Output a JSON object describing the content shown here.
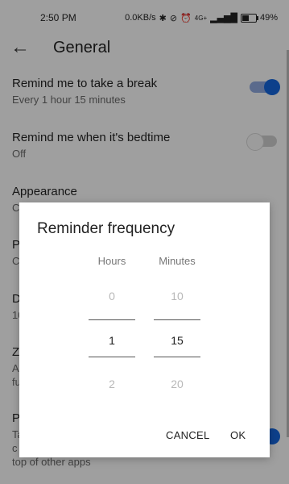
{
  "status_bar": {
    "time": "2:50 PM",
    "network_speed": "0.0KB/s",
    "battery_percent": "49%",
    "battery_level": 0.49,
    "signal_label": "4G+"
  },
  "app_bar": {
    "title": "General",
    "back_icon": "arrow-left-icon"
  },
  "settings": [
    {
      "title": "Remind me to take a break",
      "subtitle": "Every 1 hour 15 minutes",
      "toggle": true
    },
    {
      "title": "Remind me when it's bedtime",
      "subtitle": "Off",
      "toggle": false
    },
    {
      "title": "Appearance",
      "subtitle": "C"
    },
    {
      "title": "P",
      "subtitle": "C"
    },
    {
      "title": "D",
      "subtitle": "10"
    },
    {
      "title": "Z",
      "subtitle": "A",
      "subtitle2": "fu"
    },
    {
      "title": "P",
      "subtitle": "Ta",
      "subtitle2": "c",
      "subtitle3": "top of other apps"
    }
  ],
  "dialog": {
    "title": "Reminder frequency",
    "hours": {
      "label": "Hours",
      "prev": "0",
      "value": "1",
      "next": "2"
    },
    "minutes": {
      "label": "Minutes",
      "prev": "10",
      "value": "15",
      "next": "20"
    },
    "cancel_label": "CANCEL",
    "ok_label": "OK"
  },
  "colors": {
    "accent": "#1463d6"
  }
}
